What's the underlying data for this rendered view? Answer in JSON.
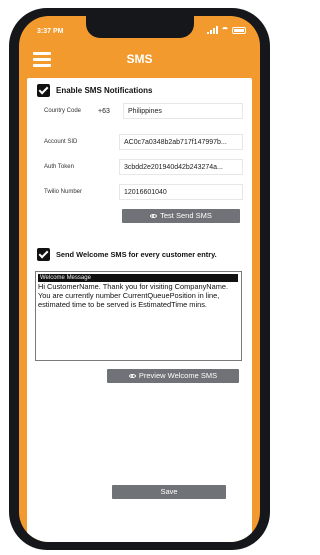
{
  "status": {
    "time": "3:37 PM"
  },
  "header": {
    "title": "SMS"
  },
  "sms": {
    "enable_label": "Enable SMS Notifications",
    "country_code": {
      "label": "Country Code",
      "code": "+63",
      "country": "Philippines"
    },
    "account_sid": {
      "label": "Account SID",
      "value": "AC0c7a0348b2ab717f147997b..."
    },
    "auth_token": {
      "label": "Auth Token",
      "value": "3cbdd2e201940d42b243274a..."
    },
    "twilio_number": {
      "label": "Twilio Number",
      "value": "12016601040"
    },
    "test_button": "Test Send SMS"
  },
  "welcome": {
    "checkbox_label": "Send Welcome SMS for every customer entry.",
    "message_title": "Welcome Message",
    "message_body": "Hi CustomerName. Thank you for visiting CompanyName. You are currently number CurrentQueuePosition in line, estimated time to be served is EstimatedTime mins.",
    "preview_button": "Preview Welcome SMS"
  },
  "footer": {
    "save_button": "Save"
  }
}
